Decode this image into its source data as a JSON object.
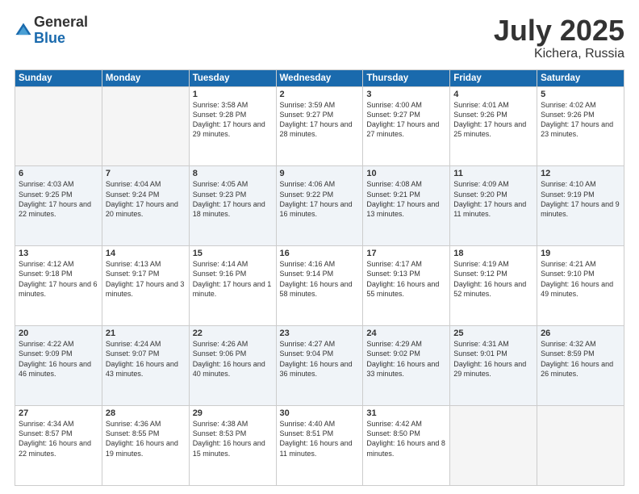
{
  "logo": {
    "general": "General",
    "blue": "Blue"
  },
  "title": "July 2025",
  "location": "Kichera, Russia",
  "days_of_week": [
    "Sunday",
    "Monday",
    "Tuesday",
    "Wednesday",
    "Thursday",
    "Friday",
    "Saturday"
  ],
  "weeks": [
    [
      {
        "num": "",
        "sunrise": "",
        "sunset": "",
        "daylight": ""
      },
      {
        "num": "",
        "sunrise": "",
        "sunset": "",
        "daylight": ""
      },
      {
        "num": "1",
        "sunrise": "Sunrise: 3:58 AM",
        "sunset": "Sunset: 9:28 PM",
        "daylight": "Daylight: 17 hours and 29 minutes."
      },
      {
        "num": "2",
        "sunrise": "Sunrise: 3:59 AM",
        "sunset": "Sunset: 9:27 PM",
        "daylight": "Daylight: 17 hours and 28 minutes."
      },
      {
        "num": "3",
        "sunrise": "Sunrise: 4:00 AM",
        "sunset": "Sunset: 9:27 PM",
        "daylight": "Daylight: 17 hours and 27 minutes."
      },
      {
        "num": "4",
        "sunrise": "Sunrise: 4:01 AM",
        "sunset": "Sunset: 9:26 PM",
        "daylight": "Daylight: 17 hours and 25 minutes."
      },
      {
        "num": "5",
        "sunrise": "Sunrise: 4:02 AM",
        "sunset": "Sunset: 9:26 PM",
        "daylight": "Daylight: 17 hours and 23 minutes."
      }
    ],
    [
      {
        "num": "6",
        "sunrise": "Sunrise: 4:03 AM",
        "sunset": "Sunset: 9:25 PM",
        "daylight": "Daylight: 17 hours and 22 minutes."
      },
      {
        "num": "7",
        "sunrise": "Sunrise: 4:04 AM",
        "sunset": "Sunset: 9:24 PM",
        "daylight": "Daylight: 17 hours and 20 minutes."
      },
      {
        "num": "8",
        "sunrise": "Sunrise: 4:05 AM",
        "sunset": "Sunset: 9:23 PM",
        "daylight": "Daylight: 17 hours and 18 minutes."
      },
      {
        "num": "9",
        "sunrise": "Sunrise: 4:06 AM",
        "sunset": "Sunset: 9:22 PM",
        "daylight": "Daylight: 17 hours and 16 minutes."
      },
      {
        "num": "10",
        "sunrise": "Sunrise: 4:08 AM",
        "sunset": "Sunset: 9:21 PM",
        "daylight": "Daylight: 17 hours and 13 minutes."
      },
      {
        "num": "11",
        "sunrise": "Sunrise: 4:09 AM",
        "sunset": "Sunset: 9:20 PM",
        "daylight": "Daylight: 17 hours and 11 minutes."
      },
      {
        "num": "12",
        "sunrise": "Sunrise: 4:10 AM",
        "sunset": "Sunset: 9:19 PM",
        "daylight": "Daylight: 17 hours and 9 minutes."
      }
    ],
    [
      {
        "num": "13",
        "sunrise": "Sunrise: 4:12 AM",
        "sunset": "Sunset: 9:18 PM",
        "daylight": "Daylight: 17 hours and 6 minutes."
      },
      {
        "num": "14",
        "sunrise": "Sunrise: 4:13 AM",
        "sunset": "Sunset: 9:17 PM",
        "daylight": "Daylight: 17 hours and 3 minutes."
      },
      {
        "num": "15",
        "sunrise": "Sunrise: 4:14 AM",
        "sunset": "Sunset: 9:16 PM",
        "daylight": "Daylight: 17 hours and 1 minute."
      },
      {
        "num": "16",
        "sunrise": "Sunrise: 4:16 AM",
        "sunset": "Sunset: 9:14 PM",
        "daylight": "Daylight: 16 hours and 58 minutes."
      },
      {
        "num": "17",
        "sunrise": "Sunrise: 4:17 AM",
        "sunset": "Sunset: 9:13 PM",
        "daylight": "Daylight: 16 hours and 55 minutes."
      },
      {
        "num": "18",
        "sunrise": "Sunrise: 4:19 AM",
        "sunset": "Sunset: 9:12 PM",
        "daylight": "Daylight: 16 hours and 52 minutes."
      },
      {
        "num": "19",
        "sunrise": "Sunrise: 4:21 AM",
        "sunset": "Sunset: 9:10 PM",
        "daylight": "Daylight: 16 hours and 49 minutes."
      }
    ],
    [
      {
        "num": "20",
        "sunrise": "Sunrise: 4:22 AM",
        "sunset": "Sunset: 9:09 PM",
        "daylight": "Daylight: 16 hours and 46 minutes."
      },
      {
        "num": "21",
        "sunrise": "Sunrise: 4:24 AM",
        "sunset": "Sunset: 9:07 PM",
        "daylight": "Daylight: 16 hours and 43 minutes."
      },
      {
        "num": "22",
        "sunrise": "Sunrise: 4:26 AM",
        "sunset": "Sunset: 9:06 PM",
        "daylight": "Daylight: 16 hours and 40 minutes."
      },
      {
        "num": "23",
        "sunrise": "Sunrise: 4:27 AM",
        "sunset": "Sunset: 9:04 PM",
        "daylight": "Daylight: 16 hours and 36 minutes."
      },
      {
        "num": "24",
        "sunrise": "Sunrise: 4:29 AM",
        "sunset": "Sunset: 9:02 PM",
        "daylight": "Daylight: 16 hours and 33 minutes."
      },
      {
        "num": "25",
        "sunrise": "Sunrise: 4:31 AM",
        "sunset": "Sunset: 9:01 PM",
        "daylight": "Daylight: 16 hours and 29 minutes."
      },
      {
        "num": "26",
        "sunrise": "Sunrise: 4:32 AM",
        "sunset": "Sunset: 8:59 PM",
        "daylight": "Daylight: 16 hours and 26 minutes."
      }
    ],
    [
      {
        "num": "27",
        "sunrise": "Sunrise: 4:34 AM",
        "sunset": "Sunset: 8:57 PM",
        "daylight": "Daylight: 16 hours and 22 minutes."
      },
      {
        "num": "28",
        "sunrise": "Sunrise: 4:36 AM",
        "sunset": "Sunset: 8:55 PM",
        "daylight": "Daylight: 16 hours and 19 minutes."
      },
      {
        "num": "29",
        "sunrise": "Sunrise: 4:38 AM",
        "sunset": "Sunset: 8:53 PM",
        "daylight": "Daylight: 16 hours and 15 minutes."
      },
      {
        "num": "30",
        "sunrise": "Sunrise: 4:40 AM",
        "sunset": "Sunset: 8:51 PM",
        "daylight": "Daylight: 16 hours and 11 minutes."
      },
      {
        "num": "31",
        "sunrise": "Sunrise: 4:42 AM",
        "sunset": "Sunset: 8:50 PM",
        "daylight": "Daylight: 16 hours and 8 minutes."
      },
      {
        "num": "",
        "sunrise": "",
        "sunset": "",
        "daylight": ""
      },
      {
        "num": "",
        "sunrise": "",
        "sunset": "",
        "daylight": ""
      }
    ]
  ]
}
